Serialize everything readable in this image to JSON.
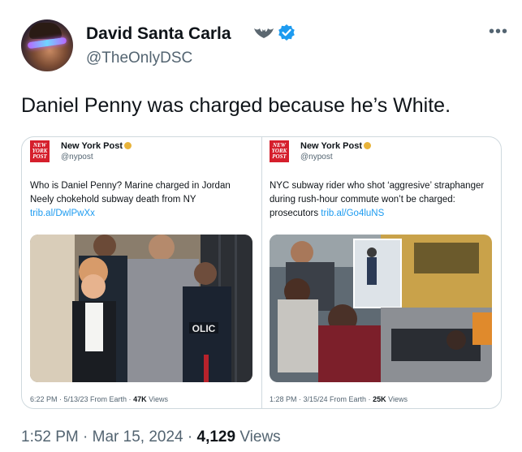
{
  "tweet": {
    "display_name": "David Santa Carla",
    "handle": "@TheOnlyDSC",
    "text": "Daniel Penny was charged because he’s White.",
    "time": "1:52 PM",
    "date": "Mar 15, 2024",
    "views_count": "4,129",
    "views_label": "Views",
    "more_glyph": "•••",
    "separator": "·"
  },
  "quotes": [
    {
      "logo_line1": "NEW",
      "logo_line2": "YORK",
      "logo_line3": "POST",
      "name": "New York Post",
      "handle": "@nypost",
      "text": "Who is Daniel Penny? Marine charged in Jordan Neely chokehold subway death from NY",
      "link": "trib.al/DwlPwXx",
      "time": "6:22 PM · 5/13/23 From Earth ·",
      "views_count": "47K",
      "views_label": "Views"
    },
    {
      "logo_line1": "NEW",
      "logo_line2": "YORK",
      "logo_line3": "POST",
      "name": "New York Post",
      "handle": "@nypost",
      "text": "NYC subway rider who shot ‘aggresive’ straphanger during rush-hour commute won’t be charged: prosecutors",
      "link": "trib.al/Go4luNS",
      "time": "1:28 PM · 3/15/24 From Earth ·",
      "views_count": "25K",
      "views_label": "Views",
      "media_sign": "OLIC"
    }
  ],
  "colors": {
    "accent": "#1d9bf0",
    "secondary_text": "#536471",
    "nypost_red": "#d51f2c",
    "gold_badge": "#e8b33a"
  }
}
